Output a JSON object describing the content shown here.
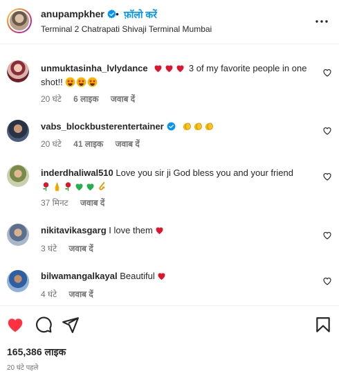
{
  "header": {
    "username": "anupampkher",
    "separator": "•",
    "follow_label": "फ़ॉलो करें",
    "location": "Terminal 2 Chatrapati Shivaji Terminal Mumbai",
    "avatar_icon": "profile-avatar-icon",
    "more_icon": "more-options-icon"
  },
  "comments": [
    {
      "username": "unmuktasinha_lvlydance",
      "text": "3 of my favorite people in one shot!!",
      "emojis_before": [
        "red-heart",
        "red-heart",
        "red-heart"
      ],
      "emojis_after": [
        "star-struck",
        "star-struck",
        "star-struck"
      ],
      "time": "20 घंटे",
      "likes": "6 लाइक",
      "reply": "जवाब दें",
      "verified": false
    },
    {
      "username": "vabs_blockbusterentertainer",
      "text": "",
      "emojis_after": [
        "clapping-hands",
        "clapping-hands",
        "clapping-hands"
      ],
      "time": "20 घंटे",
      "likes": "41 लाइक",
      "reply": "जवाब दें",
      "verified": true
    },
    {
      "username": "inderdhaliwal510",
      "text": "Love you sir ji God bless you and your friend",
      "emojis_after": [
        "rose",
        "folded-hands",
        "rose",
        "green-heart",
        "green-heart",
        "saxophone"
      ],
      "time": "37 मिनट",
      "reply": "जवाब दें",
      "verified": false
    },
    {
      "username": "nikitavikasgarg",
      "text": "I love them",
      "emojis_after": [
        "red-heart"
      ],
      "time": "3 घंटे",
      "reply": "जवाब दें",
      "verified": false
    },
    {
      "username": "bilwamangalkayal",
      "text": "Beautiful",
      "emojis_after": [
        "red-heart"
      ],
      "time": "4 घंटे",
      "reply": "जवाब दें",
      "verified": false
    }
  ],
  "actions": {
    "like_icon": "heart-filled-icon",
    "comment_icon": "comment-icon",
    "share_icon": "share-icon",
    "save_icon": "bookmark-icon"
  },
  "likes_count": "165,386 लाइक",
  "posted_time": "20 घंटे पहले",
  "colors": {
    "accent": "#0095f6",
    "like_red": "#ff3040",
    "text": "#262626",
    "muted": "#737373"
  }
}
